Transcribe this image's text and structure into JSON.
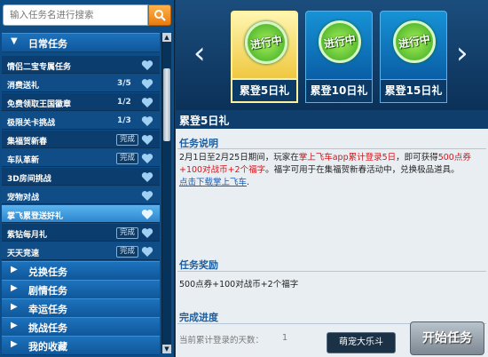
{
  "search": {
    "placeholder": "输入任务名进行搜索"
  },
  "sections": {
    "daily": "日常任务",
    "exchange": "兑换任务",
    "plot": "剧情任务",
    "lucky": "幸运任务",
    "challenge": "挑战任务",
    "favorites": "我的收藏"
  },
  "tasks": [
    {
      "name": "情侣二宝专属任务",
      "progress": "",
      "status": ""
    },
    {
      "name": "消费送礼",
      "progress": "3/5",
      "status": ""
    },
    {
      "name": "免费领取王国徽章",
      "progress": "1/2",
      "status": ""
    },
    {
      "name": "极限关卡挑战",
      "progress": "1/3",
      "status": ""
    },
    {
      "name": "集福贺新春",
      "progress": "",
      "status": "完成"
    },
    {
      "name": "车队革新",
      "progress": "",
      "status": "完成"
    },
    {
      "name": "3D房间挑战",
      "progress": "",
      "status": ""
    },
    {
      "name": "宠物对战",
      "progress": "",
      "status": ""
    },
    {
      "name": "掌飞累登送好礼",
      "progress": "",
      "status": ""
    },
    {
      "name": "紫钻每月礼",
      "progress": "",
      "status": "完成"
    },
    {
      "name": "天天竞速",
      "progress": "",
      "status": "完成"
    }
  ],
  "cards": [
    {
      "badge": "进行中",
      "label": "累登5日礼"
    },
    {
      "badge": "进行中",
      "label": "累登10日礼"
    },
    {
      "badge": "进行中",
      "label": "累登15日礼"
    }
  ],
  "detail": {
    "title": "累登5日礼",
    "desc_header": "任务说明",
    "desc_p1": "2月1日至2月25日期间，玩家在",
    "desc_red1": "掌上飞车app累计登录5日",
    "desc_p2": "，即可获得",
    "desc_red2": "500点券+100对战币+2个福字",
    "desc_p3": "。福字可用于在集福贺新春活动中，兑换极品道具。",
    "desc_link": "点击下载掌上飞车",
    "desc_end": ".",
    "reward_header": "任务奖励",
    "reward_text": "500点券+100对战币+2个福字",
    "progress_header": "完成进度",
    "progress_label": "当前累计登录的天数：",
    "progress_value": "1"
  },
  "tooltip": "萌宠大乐斗",
  "start_button": "开始任务",
  "colors": {
    "accent": "#e97c10",
    "highlight": "#d4161b",
    "link": "#1b5db6"
  }
}
